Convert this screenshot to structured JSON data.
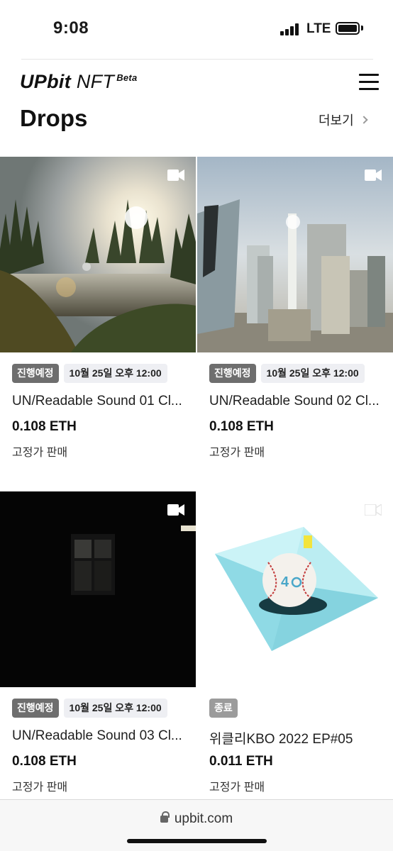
{
  "status_bar": {
    "time": "9:08",
    "network": "LTE"
  },
  "header": {
    "logo_main": "UPbit",
    "logo_nft": "NFT",
    "logo_beta": "Beta"
  },
  "section": {
    "title": "Drops",
    "more_label": "더보기"
  },
  "cards": [
    {
      "status": "진행예정",
      "date": "10월 25일 오후 12:00",
      "title": "UN/Readable Sound 01 Cl...",
      "price": "0.108 ETH",
      "sale_type": "고정가 판매",
      "icon": "video-camera-icon"
    },
    {
      "status": "진행예정",
      "date": "10월 25일 오후 12:00",
      "title": "UN/Readable Sound 02 Cl...",
      "price": "0.108 ETH",
      "sale_type": "고정가 판매",
      "icon": "video-camera-icon"
    },
    {
      "status": "진행예정",
      "date": "10월 25일 오후 12:00",
      "title": "UN/Readable Sound 03 Cl...",
      "price": "0.108 ETH",
      "sale_type": "고정가 판매",
      "icon": "video-camera-icon"
    },
    {
      "status": "종료",
      "date": "",
      "title": "위클리KBO 2022 EP#05",
      "price": "0.011 ETH",
      "sale_type": "고정가 판매",
      "icon": "video-camera-icon"
    }
  ],
  "browser": {
    "url": "upbit.com"
  },
  "colors": {
    "status_badge": "#6e6e6e",
    "ended_badge": "#9b9b9b",
    "date_badge": "#eeeff3"
  }
}
